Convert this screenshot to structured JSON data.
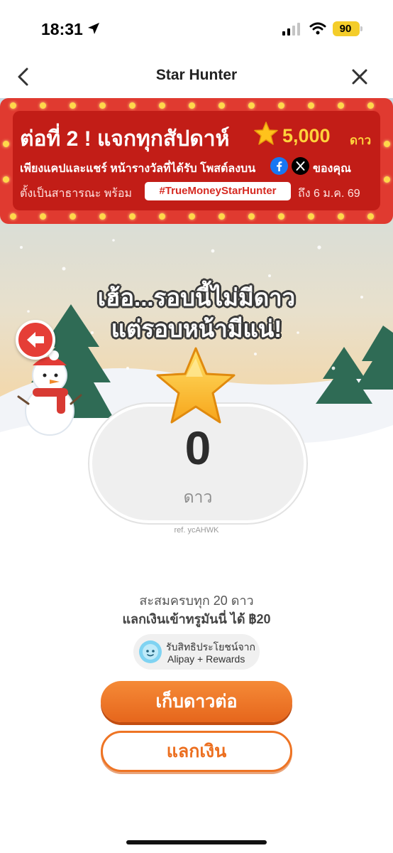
{
  "status_bar": {
    "time": "18:31",
    "battery": "90"
  },
  "nav": {
    "title": "Star Hunter",
    "back_icon": "chevron-left-icon",
    "close_icon": "close-icon"
  },
  "promo": {
    "title": "ต่อที่ 2 ! แจกทุกสัปดาห์",
    "amount": "5,000",
    "amount_unit": "ดาว",
    "line2": "เพียงแคปและแชร์ หน้ารางวัลที่ได้รับ โพสต์ลงบน",
    "line2_end": "ของคุณ",
    "line3_start": "ตั้งเป็นสาธารณะ พร้อม",
    "hashtag": "#TrueMoneyStarHunter",
    "line3_end": "ถึง 6 ม.ค. 69"
  },
  "result": {
    "headline_1": "เฮ้อ...รอบนี้ไม่มีดาว",
    "headline_2": "แต่รอบหน้ามีแน่!",
    "stars_value": "0",
    "stars_unit": "ดาว",
    "ref": "ref. ycAHWK"
  },
  "reward": {
    "collect_text": "สะสมครบทุก 20 ดาว",
    "redeem_text": "แลกเงินเข้าทรูมันนี่ ได้ ฿20",
    "partner_line1": "รับสิทธิประโยชน์จาก",
    "partner_line2": "Alipay + Rewards"
  },
  "buttons": {
    "collect_more": "เก็บดาวต่อ",
    "redeem": "แลกเงิน"
  },
  "colors": {
    "accent_orange": "#ec6f20",
    "banner_red": "#c21d17",
    "star_gold": "#ffc21c"
  }
}
